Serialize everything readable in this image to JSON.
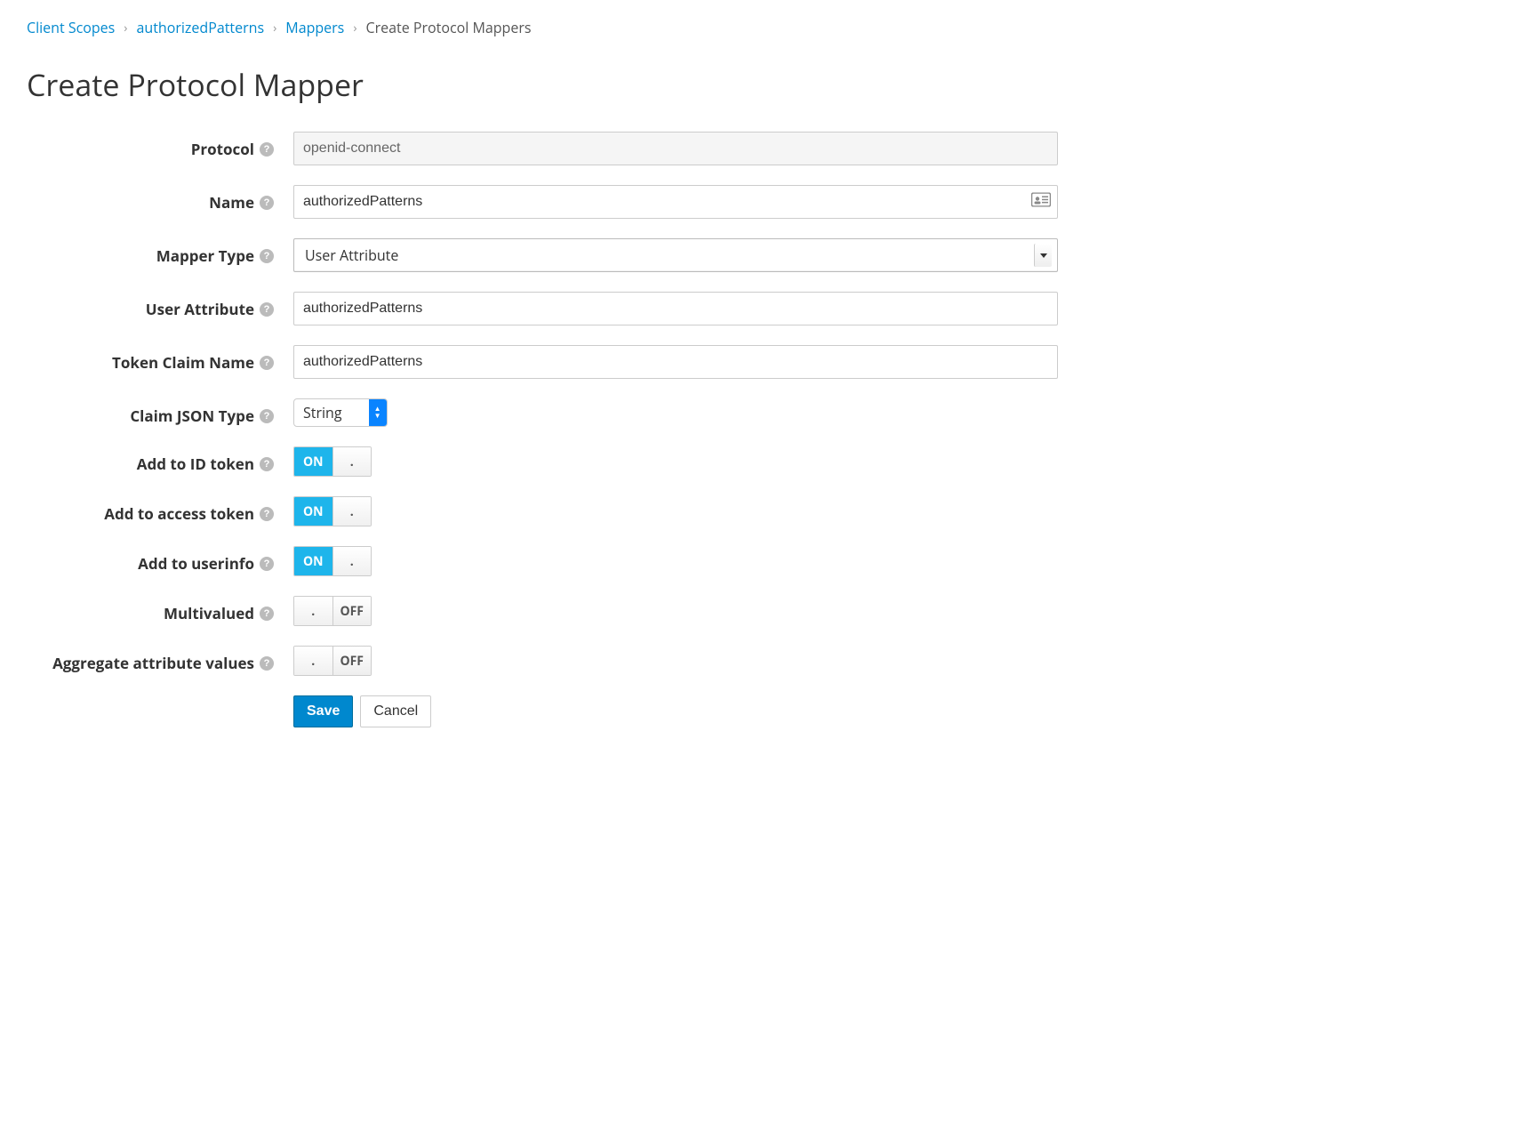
{
  "breadcrumb": {
    "items": [
      {
        "label": "Client Scopes",
        "link": true
      },
      {
        "label": "authorizedPatterns",
        "link": true
      },
      {
        "label": "Mappers",
        "link": true
      },
      {
        "label": "Create Protocol Mappers",
        "link": false
      }
    ]
  },
  "page": {
    "title": "Create Protocol Mapper"
  },
  "form": {
    "protocol": {
      "label": "Protocol",
      "value": "openid-connect"
    },
    "name": {
      "label": "Name",
      "value": "authorizedPatterns"
    },
    "mapper_type": {
      "label": "Mapper Type",
      "value": "User Attribute"
    },
    "user_attribute": {
      "label": "User Attribute",
      "value": "authorizedPatterns"
    },
    "token_claim_name": {
      "label": "Token Claim Name",
      "value": "authorizedPatterns"
    },
    "claim_json_type": {
      "label": "Claim JSON Type",
      "value": "String"
    },
    "add_to_id_token": {
      "label": "Add to ID token",
      "value": true,
      "on_text": "ON",
      "off_text": "OFF"
    },
    "add_to_access_token": {
      "label": "Add to access token",
      "value": true,
      "on_text": "ON",
      "off_text": "OFF"
    },
    "add_to_userinfo": {
      "label": "Add to userinfo",
      "value": true,
      "on_text": "ON",
      "off_text": "OFF"
    },
    "multivalued": {
      "label": "Multivalued",
      "value": false,
      "on_text": "ON",
      "off_text": "OFF"
    },
    "aggregate": {
      "label": "Aggregate attribute values",
      "value": false,
      "on_text": "ON",
      "off_text": "OFF"
    }
  },
  "buttons": {
    "save": "Save",
    "cancel": "Cancel"
  }
}
